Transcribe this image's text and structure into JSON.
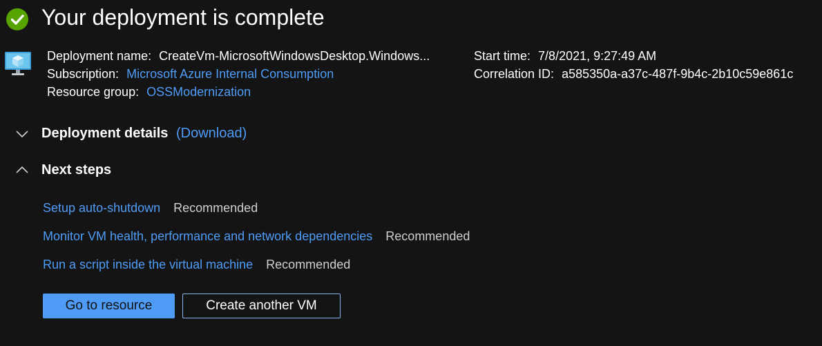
{
  "header": {
    "title": "Your deployment is complete",
    "status_color": "#57a300",
    "status_icon": "success-check-icon"
  },
  "deployment": {
    "vm_icon": "virtual-machine-icon",
    "name_label": "Deployment name:",
    "name_value": "CreateVm-MicrosoftWindowsDesktop.Windows...",
    "subscription_label": "Subscription:",
    "subscription_value": "Microsoft Azure Internal Consumption",
    "resource_group_label": "Resource group:",
    "resource_group_value": "OSSModernization",
    "start_time_label": "Start time:",
    "start_time_value": "7/8/2021, 9:27:49 AM",
    "correlation_label": "Correlation ID:",
    "correlation_value": "a585350a-a37c-487f-9b4c-2b10c59e861c"
  },
  "details_section": {
    "title": "Deployment details",
    "download_label": "(Download)",
    "expanded": false
  },
  "next_steps": {
    "title": "Next steps",
    "expanded": true,
    "items": [
      {
        "label": "Setup auto-shutdown",
        "tag": "Recommended"
      },
      {
        "label": "Monitor VM health, performance and network dependencies",
        "tag": "Recommended"
      },
      {
        "label": "Run a script inside the virtual machine",
        "tag": "Recommended"
      }
    ]
  },
  "actions": {
    "primary_label": "Go to resource",
    "secondary_label": "Create another VM"
  },
  "colors": {
    "background": "#141414",
    "link": "#4f9cf7",
    "primary_button": "#4f9cf7"
  }
}
